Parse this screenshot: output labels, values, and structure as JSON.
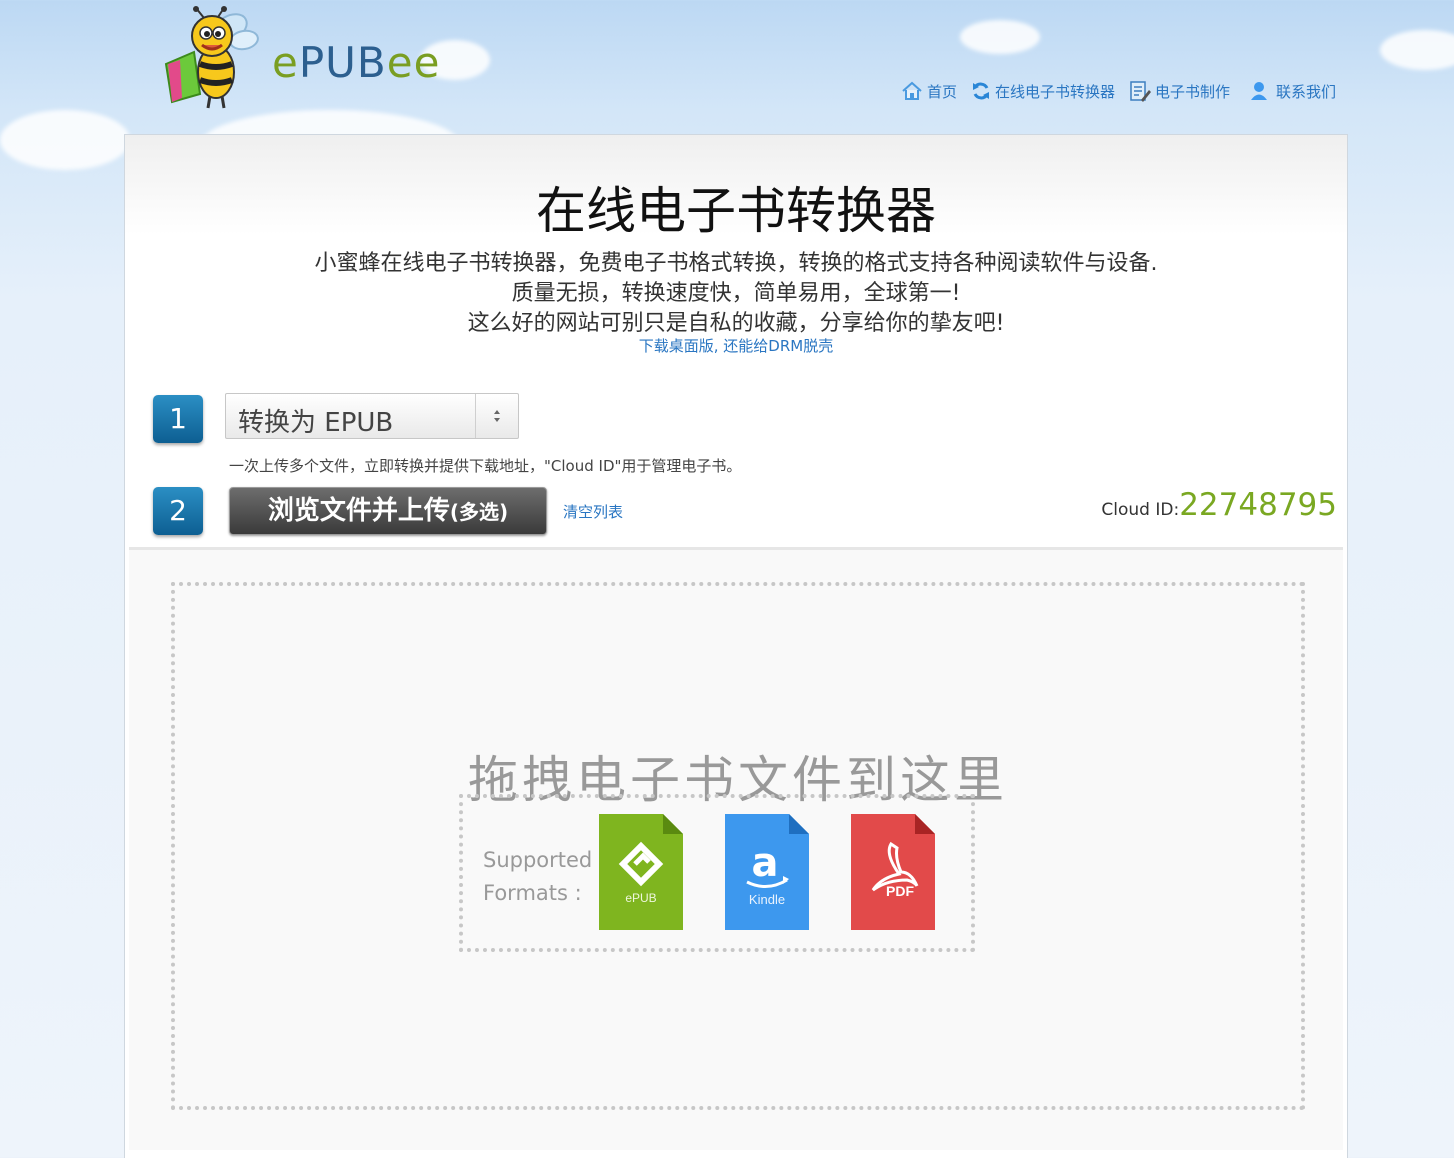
{
  "brand": {
    "logo_e1": "e",
    "logo_mid": "PUB",
    "logo_e2": "ee",
    "mascot_icon": "bee-mascot-icon"
  },
  "nav": [
    {
      "label": "首页",
      "icon": "home-icon"
    },
    {
      "label": "在线电子书转换器",
      "icon": "refresh-icon"
    },
    {
      "label": "电子书制作",
      "icon": "document-edit-icon"
    },
    {
      "label": "联系我们",
      "icon": "user-icon"
    }
  ],
  "main": {
    "title": "在线电子书转换器",
    "description_lines": [
      "小蜜蜂在线电子书转换器，免费电子书格式转换，转换的格式支持各种阅读软件与设备.",
      "质量无损，转换速度快，简单易用，全球第一!",
      "这么好的网站可别只是自私的收藏，分享给你的挚友吧!"
    ],
    "desktop_link": "下载桌面版, 还能给DRM脱壳"
  },
  "steps": {
    "step1_number": "1",
    "format_select_value": "转换为 EPUB",
    "hint": "一次上传多个文件，立即转换并提供下载地址，\"Cloud ID\"用于管理电子书。",
    "step2_number": "2",
    "upload_button_main": "浏览文件并上传",
    "upload_button_suffix": "(多选)",
    "clear_list": "清空列表",
    "cloud_id_label": "Cloud ID:",
    "cloud_id_value": "22748795"
  },
  "dropzone": {
    "title": "拖拽电子书文件到这里",
    "supported_line1": "Supported",
    "supported_line2": "Formats :",
    "formats": [
      {
        "name": "ePUB",
        "color": "#7fb51f",
        "icon": "epub-file-icon"
      },
      {
        "name": "Kindle",
        "color": "#3d98ee",
        "icon": "kindle-file-icon"
      },
      {
        "name": "PDF",
        "color": "#e24a4a",
        "icon": "pdf-file-icon"
      }
    ]
  },
  "colors": {
    "link": "#2a76c2",
    "cloud_id": "#7aa822",
    "step_badge": "#1476ad"
  }
}
